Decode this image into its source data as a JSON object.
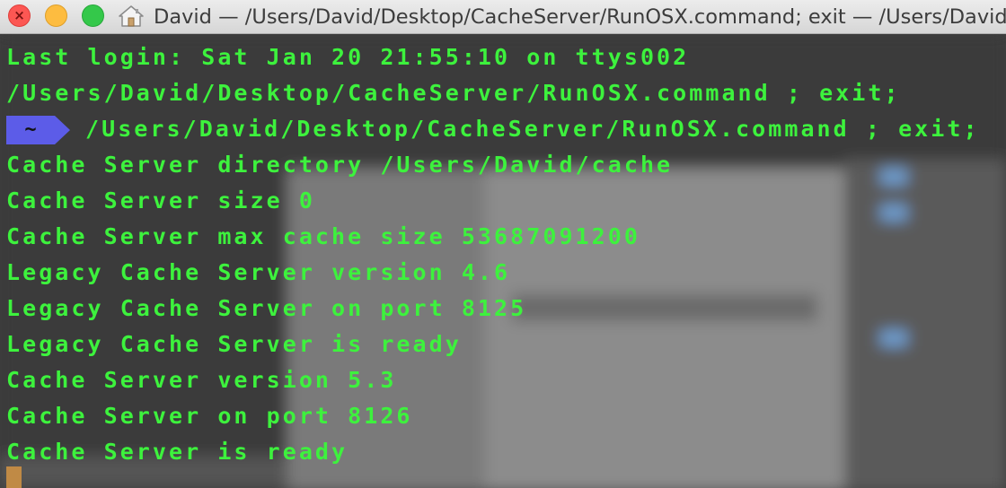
{
  "window": {
    "title": "David — /Users/David/Desktop/CacheServer/RunOSX.command; exit — /Users/David",
    "close_symbol": "×"
  },
  "icons": {
    "close": "close-icon",
    "minimize": "minimize-icon",
    "zoom": "zoom-icon",
    "home": "home-icon",
    "prompt_arrow": "prompt-arrow-icon"
  },
  "colors": {
    "terminal_text": "#3df23d",
    "prompt_segment": "#5c5ce8",
    "cursor": "#c08a45",
    "traffic_close": "#fc5753",
    "traffic_minimize": "#fdbc40",
    "traffic_zoom": "#34c84a"
  },
  "terminal": {
    "last_login": "Last login: Sat Jan 20 21:55:10 on ttys002",
    "command_echo": "/Users/David/Desktop/CacheServer/RunOSX.command ; exit;",
    "prompt_dir": "~",
    "prompt_command": "/Users/David/Desktop/CacheServer/RunOSX.command ; exit;",
    "output": [
      "Cache Server directory /Users/David/cache",
      "Cache Server size 0",
      "Cache Server max cache size 53687091200",
      "Legacy Cache Server version 4.6",
      "Legacy Cache Server on port 8125",
      "Legacy Cache Server is ready",
      "Cache Server version 5.3",
      "Cache Server on port 8126",
      "Cache Server is ready"
    ]
  }
}
